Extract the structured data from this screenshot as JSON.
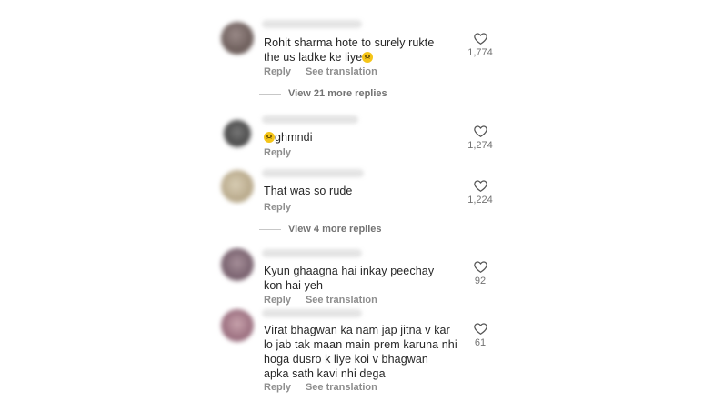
{
  "comments": [
    {
      "text": "Rohit sharma hote to surely rukte\nthe us ladke ke liye",
      "emoji_after": "disappointed-face-emoji",
      "actions": [
        "Reply",
        "See translation"
      ],
      "likes": "1,774",
      "view_replies": "View 21 more replies"
    },
    {
      "text": "ghmndi",
      "emoji_before": "disappointed-face-emoji",
      "actions": [
        "Reply"
      ],
      "likes": "1,274"
    },
    {
      "text": "That was so rude",
      "actions": [
        "Reply"
      ],
      "likes": "1,224",
      "view_replies": "View 4 more replies"
    },
    {
      "text": "Kyun ghaagna hai inkay peechay\nkon hai yeh",
      "actions": [
        "Reply",
        "See translation"
      ],
      "likes": "92"
    },
    {
      "text": "Virat bhagwan ka nam jap jitna v kar\nlo jab tak maan main prem karuna nhi\nhoga dusro k liye koi v bhagwan\napka sath kavi nhi dega",
      "actions": [
        "Reply",
        "See translation"
      ],
      "likes": "61"
    }
  ],
  "icons": {
    "like": "heart-outline-icon"
  },
  "colors": {
    "text": "#262626",
    "secondary": "#8e8e8e",
    "background": "#ffffff"
  }
}
